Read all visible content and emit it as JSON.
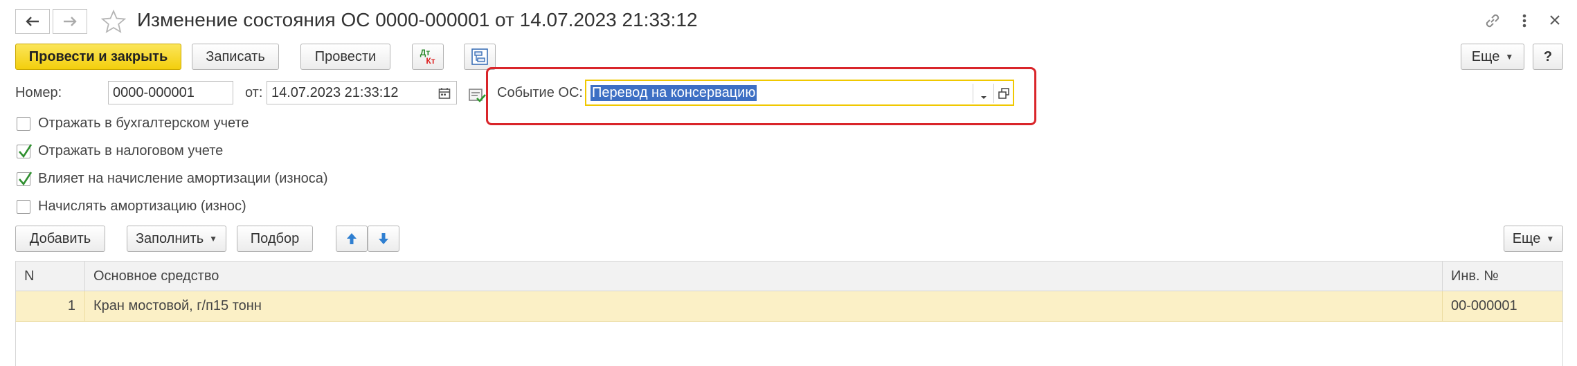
{
  "window": {
    "title": "Изменение состояния ОС 0000-000001 от 14.07.2023 21:33:12"
  },
  "toolbar": {
    "post_close_label": "Провести и закрыть",
    "save_label": "Записать",
    "post_label": "Провести",
    "dtkt_dt": "Дт",
    "dtkt_kt": "Кт",
    "more_label": "Еще",
    "help_label": "?"
  },
  "form": {
    "number_label": "Номер:",
    "number_value": "0000-000001",
    "date_label": "от:",
    "date_value": "14.07.2023 21:33:12",
    "event_label": "Событие ОС:",
    "event_value": "Перевод на консервацию"
  },
  "checkboxes": [
    {
      "label": "Отражать в бухгалтерском учете",
      "checked": false
    },
    {
      "label": "Отражать в налоговом учете",
      "checked": true
    },
    {
      "label": "Влияет на начисление амортизации (износа)",
      "checked": true
    },
    {
      "label": "Начислять амортизацию (износ)",
      "checked": false
    }
  ],
  "table_toolbar": {
    "add_label": "Добавить",
    "fill_label": "Заполнить",
    "select_label": "Подбор",
    "more_label": "Еще"
  },
  "table": {
    "columns": [
      "N",
      "Основное средство",
      "Инв. №"
    ],
    "rows": [
      {
        "n": "1",
        "asset": "Кран мостовой, г/п15 тонн",
        "inv": "00-000001"
      }
    ]
  },
  "colors": {
    "primary_button": "#f3cf0d",
    "highlight_frame": "#d9252a",
    "selected_row": "#fbf0c6",
    "selection_text_bg": "#3d6fc4"
  }
}
